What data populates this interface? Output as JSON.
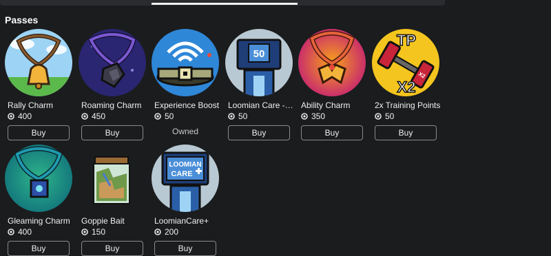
{
  "section_title": "Passes",
  "items": [
    {
      "name": "Rally Charm",
      "price": "400",
      "action": "Buy"
    },
    {
      "name": "Roaming Charm",
      "price": "450",
      "action": "Buy"
    },
    {
      "name": "Experience Boost",
      "price": "50",
      "action": "Owned"
    },
    {
      "name": "Loomian Care - 5...",
      "price": "50",
      "action": "Buy"
    },
    {
      "name": "Ability Charm",
      "price": "350",
      "action": "Buy"
    },
    {
      "name": "2x Training Points",
      "price": "50",
      "action": "Buy"
    },
    {
      "name": "Gleaming Charm",
      "price": "400",
      "action": "Buy"
    },
    {
      "name": "Goppie Bait",
      "price": "150",
      "action": "Buy"
    },
    {
      "name": "LoomianCare+",
      "price": "200",
      "action": "Buy"
    }
  ],
  "thumb_text": {
    "loomian_care_number": "50",
    "tp_top": "TP",
    "tp_bottom": "X2",
    "tp_weight_label": "X2",
    "care_plus_line1": "LOOMIAN",
    "care_plus_line2": "CARE"
  },
  "icons": {
    "currency": "robux-icon"
  }
}
